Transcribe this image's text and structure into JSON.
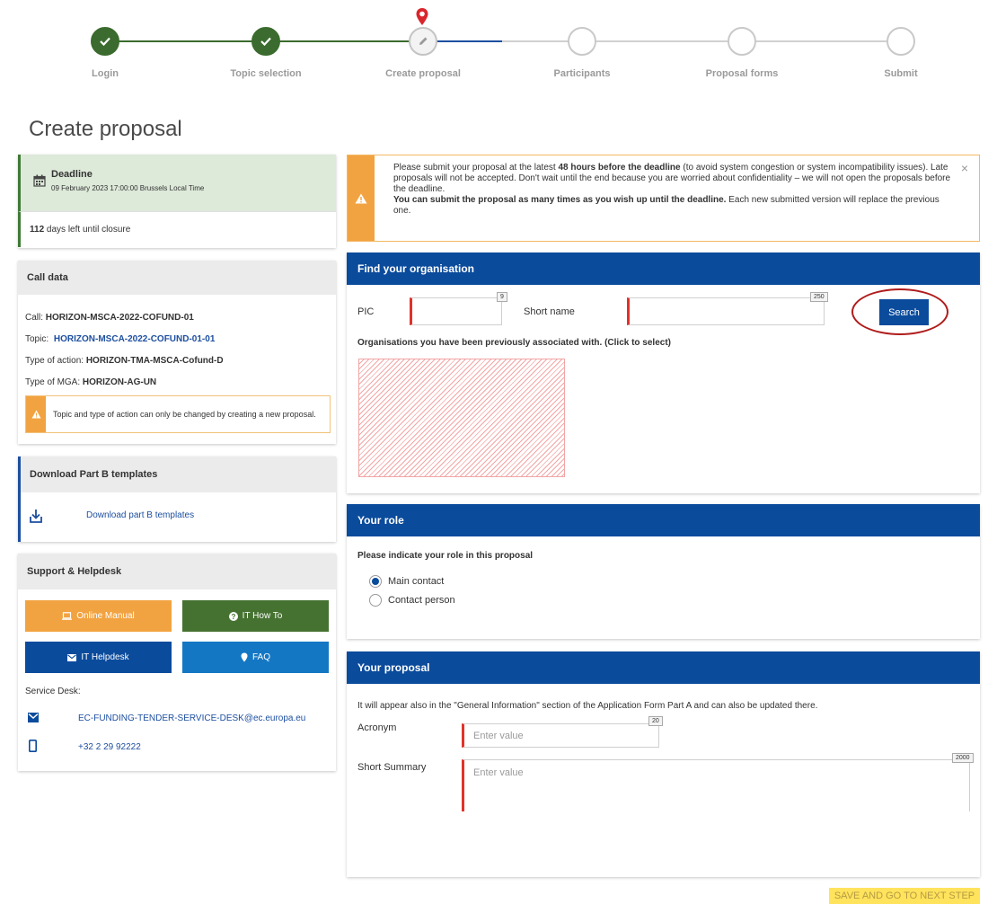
{
  "stepper": {
    "steps": [
      {
        "label": "Login",
        "state": "done"
      },
      {
        "label": "Topic selection",
        "state": "done"
      },
      {
        "label": "Create proposal",
        "state": "current"
      },
      {
        "label": "Participants",
        "state": "todo"
      },
      {
        "label": "Proposal forms",
        "state": "todo"
      },
      {
        "label": "Submit",
        "state": "todo"
      }
    ]
  },
  "page": {
    "title": "Create proposal"
  },
  "deadline": {
    "label": "Deadline",
    "date": "09 February 2023 17:00:00 Brussels Local Time",
    "days_left": "112",
    "days_left_text": "days left until closure"
  },
  "call_data": {
    "title": "Call data",
    "call_label": "Call:",
    "call_value": "HORIZON-MSCA-2022-COFUND-01",
    "topic_label": "Topic:",
    "topic_value": "HORIZON-MSCA-2022-COFUND-01-01",
    "action_label": "Type of action:",
    "action_value": "HORIZON-TMA-MSCA-Cofund-D",
    "mga_label": "Type of MGA:",
    "mga_value": "HORIZON-AG-UN",
    "warning": "Topic and type of action can only be changed by creating a new proposal."
  },
  "download": {
    "title": "Download Part B templates",
    "link": "Download part B templates"
  },
  "support": {
    "title": "Support & Helpdesk",
    "online_manual": "Online Manual",
    "it_how_to": "IT How To",
    "it_helpdesk": "IT Helpdesk",
    "faq": "FAQ",
    "service_desk": "Service Desk:",
    "email": "EC-FUNDING-TENDER-SERVICE-DESK@ec.europa.eu",
    "phone": "+32 2 29 92222"
  },
  "notice": {
    "text_1": "Please submit your proposal at the latest ",
    "bold_1": "48 hours before the deadline",
    "text_2": " (to avoid system congestion or system incompatibility issues). Late proposals will not be accepted. Don't wait until the end because you are worried about confidentiality – we will not open the proposals before the deadline.",
    "bold_2": "You can submit the proposal as many times as you wish up until the deadline.",
    "text_3": " Each new submitted version will replace the previous one.",
    "close": "×"
  },
  "find_org": {
    "title": "Find your organisation",
    "pic_label": "PIC",
    "pic_max": "9",
    "short_name_label": "Short name",
    "short_name_max": "250",
    "search_button": "Search",
    "previous_label": "Organisations you have been previously associated with. (Click to select)"
  },
  "role": {
    "title": "Your role",
    "question": "Please indicate your role in this proposal",
    "options": [
      "Main contact",
      "Contact person"
    ],
    "selected": "Main contact"
  },
  "proposal": {
    "title": "Your proposal",
    "info": "It will appear also in the \"General Information\" section of the Application Form Part A and can also be updated there.",
    "acronym_label": "Acronym",
    "acronym_max": "20",
    "acronym_placeholder": "Enter value",
    "summary_label": "Short Summary",
    "summary_max": "2000",
    "summary_placeholder": "Enter value"
  },
  "footer": {
    "next_button": "SAVE AND GO TO NEXT STEP"
  },
  "colors": {
    "done": "#3b6b2e",
    "primary_blue": "#0b4b9c",
    "warning_orange": "#f2a341",
    "highlight_red": "#b01c1c",
    "next_button": "#ffe35c"
  }
}
